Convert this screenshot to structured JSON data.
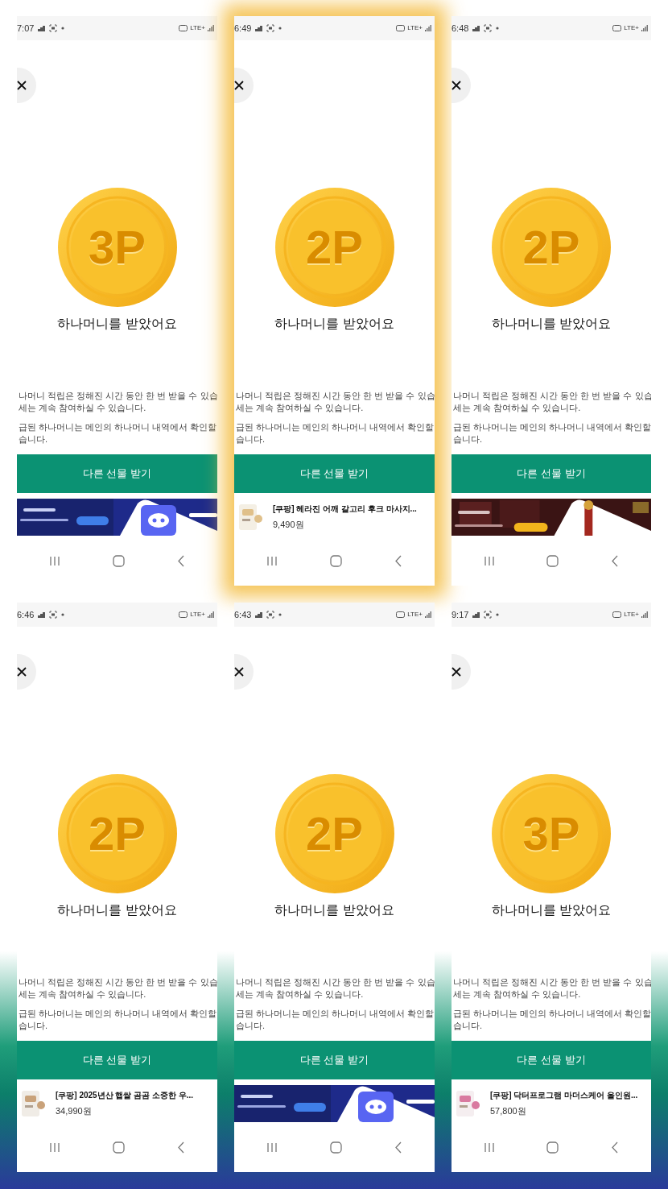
{
  "panels": [
    {
      "status_bar": {
        "time": "7:07",
        "network": "LTE+"
      },
      "coin": {
        "label": "3P"
      },
      "title": "하나머니를 받았어요",
      "notice_lines": [
        "나머니 적립은 정해진 시간 동안 한 번 받을 수 있습",
        "세는 계속 참여하실 수 있습니다.",
        "급된 하나머니는 메인의 하나머니 내역에서 확인할",
        "습니다."
      ],
      "button": "다른 선물 받기",
      "ad": {
        "kind": "chat"
      }
    },
    {
      "status_bar": {
        "time": "6:49",
        "network": "LTE+"
      },
      "coin": {
        "label": "2P"
      },
      "title": "하나머니를 받았어요",
      "notice_lines": [
        "나머니 적립은 정해진 시간 동안 한 번 받을 수 있습",
        "세는 계속 참여하실 수 있습니다.",
        "급된 하나머니는 메인의 하나머니 내역에서 확인할",
        "습니다."
      ],
      "button": "다른 선물 받기",
      "ad": {
        "kind": "product",
        "title": "[쿠팡] 헤라진 어깨 갈고리 후크 마사지...",
        "price": "9,490원"
      }
    },
    {
      "status_bar": {
        "time": "6:48",
        "network": "LTE+"
      },
      "coin": {
        "label": "2P"
      },
      "title": "하나머니를 받았어요",
      "notice_lines": [
        "나머니 적립은 정해진 시간 동안 한 번 받을 수 있습",
        "세는 계속 참여하실 수 있습니다.",
        "급된 하나머니는 메인의 하나머니 내역에서 확인할",
        "습니다."
      ],
      "button": "다른 선물 받기",
      "ad": {
        "kind": "game"
      }
    },
    {
      "status_bar": {
        "time": "6:46",
        "network": "LTE+"
      },
      "coin": {
        "label": "2P"
      },
      "title": "하나머니를 받았어요",
      "notice_lines": [
        "나머니 적립은 정해진 시간 동안 한 번 받을 수 있습",
        "세는 계속 참여하실 수 있습니다.",
        "급된 하나머니는 메인의 하나머니 내역에서 확인할",
        "습니다."
      ],
      "button": "다른 선물 받기",
      "ad": {
        "kind": "product",
        "title": "[쿠팡] 2025년산 햅쌀 곰곰 소중한 우...",
        "price": "34,990원"
      }
    },
    {
      "status_bar": {
        "time": "6:43",
        "network": "LTE+"
      },
      "coin": {
        "label": "2P"
      },
      "title": "하나머니를 받았어요",
      "notice_lines": [
        "나머니 적립은 정해진 시간 동안 한 번 받을 수 있습",
        "세는 계속 참여하실 수 있습니다.",
        "급된 하나머니는 메인의 하나머니 내역에서 확인할",
        "습니다."
      ],
      "button": "다른 선물 받기",
      "ad": {
        "kind": "chat"
      }
    },
    {
      "status_bar": {
        "time": "9:17",
        "network": "LTE+"
      },
      "coin": {
        "label": "3P"
      },
      "title": "하나머니를 받았어요",
      "notice_lines": [
        "나머니 적립은 정해진 시간 동안 한 번 받을 수 있습",
        "세는 계속 참여하실 수 있습니다.",
        "급된 하나머니는 메인의 하나머니 내역에서 확인할",
        "습니다."
      ],
      "button": "다른 선물 받기",
      "ad": {
        "kind": "product",
        "title": "[쿠팡] 닥터프로그램 마더스케어 올인원...",
        "price": "57,800원"
      }
    }
  ]
}
